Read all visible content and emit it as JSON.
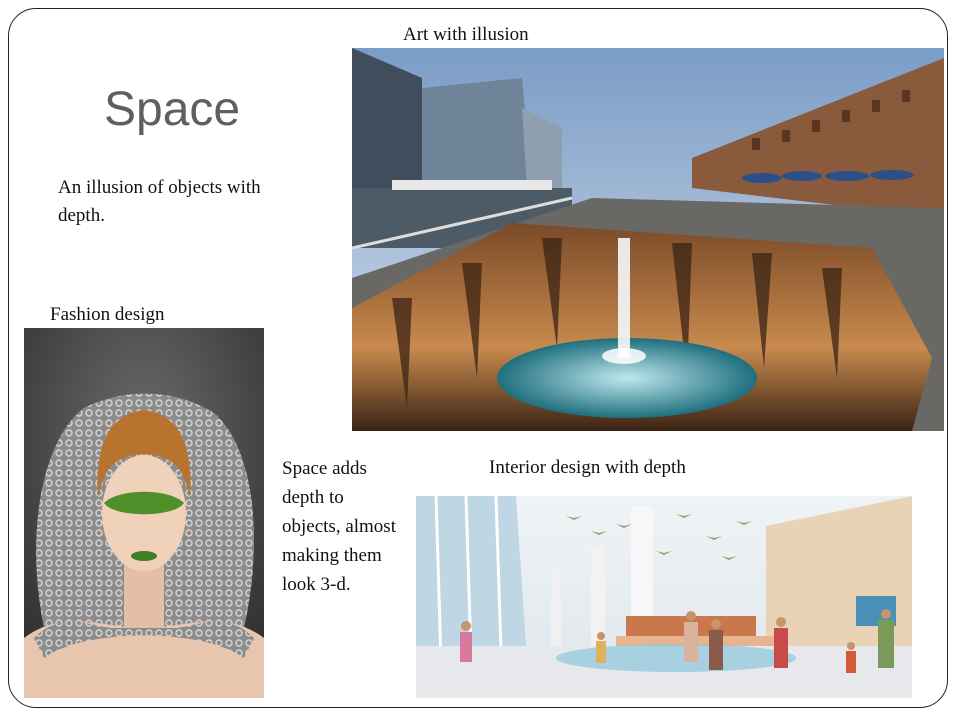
{
  "slide": {
    "title": "Space",
    "description": "An illusion of objects with depth.",
    "captions": {
      "art": "Art with illusion",
      "fashion": "Fashion design",
      "interior": "Interior design with depth"
    },
    "side_text": "Space adds depth to objects, almost making them look 3-d."
  },
  "colors": {
    "title": "#5f5f5f",
    "text": "#111111",
    "border": "#222222"
  }
}
